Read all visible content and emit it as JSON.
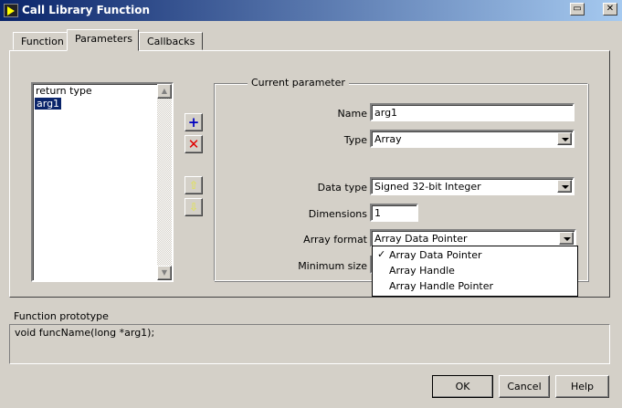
{
  "window": {
    "title": "Call Library Function",
    "restore_icon": "restore-icon",
    "close_icon": "close-icon"
  },
  "tabs": [
    {
      "label": "Function"
    },
    {
      "label": "Parameters",
      "selected": true
    },
    {
      "label": "Callbacks"
    }
  ],
  "param_list": {
    "items": [
      "return type",
      "arg1"
    ],
    "selected": "arg1"
  },
  "param_buttons": {
    "add": "plus-icon",
    "delete": "delete-x-icon",
    "up": "arrow-up-icon",
    "down": "arrow-down-icon"
  },
  "current_parameter": {
    "group_label": "Current parameter",
    "name_label": "Name",
    "name_value": "arg1",
    "type_label": "Type",
    "type_value": "Array",
    "data_type_label": "Data type",
    "data_type_value": "Signed 32-bit Integer",
    "dimensions_label": "Dimensions",
    "dimensions_value": "1",
    "array_format_label": "Array format",
    "array_format_value": "Array Data Pointer",
    "array_format_options": [
      "Array Data Pointer",
      "Array Handle",
      "Array Handle Pointer"
    ],
    "check_mark": "✓",
    "minimum_size_label": "Minimum size"
  },
  "prototype": {
    "label": "Function prototype",
    "value": "void funcName(long *arg1);"
  },
  "buttons": {
    "ok": "OK",
    "cancel": "Cancel",
    "help": "Help"
  },
  "colors": {
    "titlebar_start": "#0a246a",
    "titlebar_end": "#a6caf0",
    "selection": "#0a246a",
    "face": "#d4d0c8"
  }
}
